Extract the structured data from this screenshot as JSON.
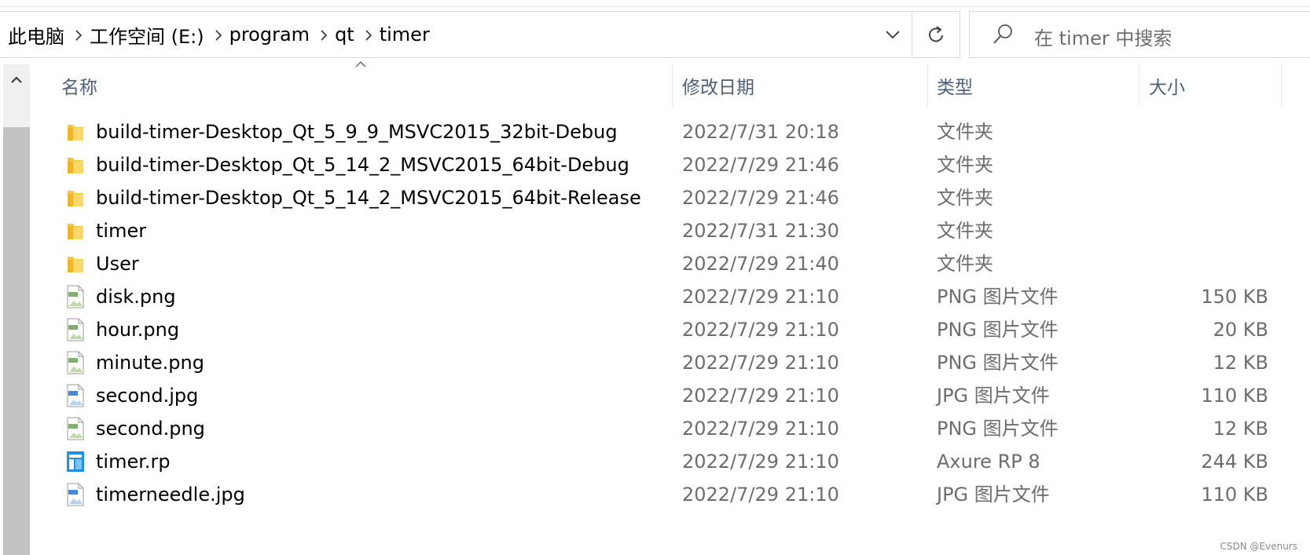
{
  "address_bar": {
    "breadcrumbs": [
      "此电脑",
      "工作空间 (E:)",
      "program",
      "qt",
      "timer"
    ]
  },
  "search": {
    "placeholder": "在 timer 中搜索"
  },
  "columns": {
    "name": "名称",
    "date": "修改日期",
    "type": "类型",
    "size": "大小"
  },
  "files": [
    {
      "name": "build-timer-Desktop_Qt_5_9_9_MSVC2015_32bit-Debug",
      "date": "2022/7/31 20:18",
      "type": "文件夹",
      "size": "",
      "icon": "folder-icon"
    },
    {
      "name": "build-timer-Desktop_Qt_5_14_2_MSVC2015_64bit-Debug",
      "date": "2022/7/29 21:46",
      "type": "文件夹",
      "size": "",
      "icon": "folder-icon"
    },
    {
      "name": "build-timer-Desktop_Qt_5_14_2_MSVC2015_64bit-Release",
      "date": "2022/7/29 21:46",
      "type": "文件夹",
      "size": "",
      "icon": "folder-icon"
    },
    {
      "name": "timer",
      "date": "2022/7/31 21:30",
      "type": "文件夹",
      "size": "",
      "icon": "folder-icon"
    },
    {
      "name": "User",
      "date": "2022/7/29 21:40",
      "type": "文件夹",
      "size": "",
      "icon": "folder-icon"
    },
    {
      "name": "disk.png",
      "date": "2022/7/29 21:10",
      "type": "PNG 图片文件",
      "size": "150 KB",
      "icon": "png-file-icon"
    },
    {
      "name": "hour.png",
      "date": "2022/7/29 21:10",
      "type": "PNG 图片文件",
      "size": "20 KB",
      "icon": "png-file-icon"
    },
    {
      "name": "minute.png",
      "date": "2022/7/29 21:10",
      "type": "PNG 图片文件",
      "size": "12 KB",
      "icon": "png-file-icon"
    },
    {
      "name": "second.jpg",
      "date": "2022/7/29 21:10",
      "type": "JPG 图片文件",
      "size": "110 KB",
      "icon": "jpg-file-icon"
    },
    {
      "name": "second.png",
      "date": "2022/7/29 21:10",
      "type": "PNG 图片文件",
      "size": "12 KB",
      "icon": "png-file-icon"
    },
    {
      "name": "timer.rp",
      "date": "2022/7/29 21:10",
      "type": "Axure RP 8",
      "size": "244 KB",
      "icon": "axure-file-icon"
    },
    {
      "name": "timerneedle.jpg",
      "date": "2022/7/29 21:10",
      "type": "JPG 图片文件",
      "size": "110 KB",
      "icon": "jpg-file-icon"
    }
  ],
  "watermark": "CSDN @Evenurs",
  "colors": {
    "folder": "#f6c543",
    "png_badge": "#7fb26a",
    "jpg_badge": "#4a86d9",
    "axure": "#1e8fe1",
    "header_text": "#4c607a"
  }
}
